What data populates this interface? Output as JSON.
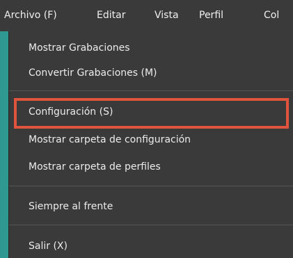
{
  "menubar": {
    "items": [
      {
        "label": "Archivo (F)"
      },
      {
        "label": "Editar"
      },
      {
        "label": "Vista"
      },
      {
        "label": "Perfil"
      },
      {
        "label": "Col"
      }
    ]
  },
  "dropdown": {
    "items": [
      {
        "label": "Mostrar Grabaciones"
      },
      {
        "label": "Convertir Grabaciones (M)"
      },
      {
        "label": "Configuración (S)"
      },
      {
        "label": "Mostrar carpeta de configuración"
      },
      {
        "label": "Mostrar carpeta de perfiles"
      },
      {
        "label": "Siempre al frente"
      },
      {
        "label": "Salir (X)"
      }
    ]
  },
  "colors": {
    "background": "#2f9890",
    "menu_background": "#3a3a3a",
    "highlight_border": "#e0533d",
    "text": "#ececec"
  }
}
